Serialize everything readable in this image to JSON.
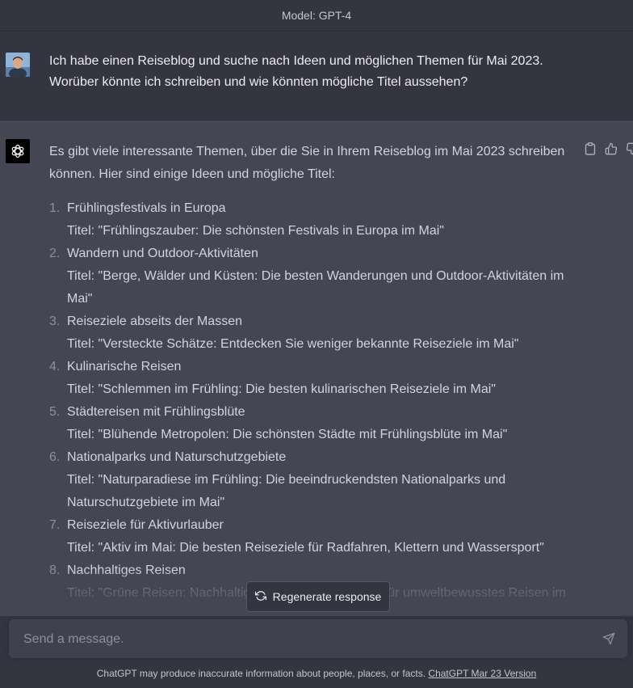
{
  "header": {
    "model_label": "Model: GPT-4"
  },
  "user_message": {
    "lines": [
      "Ich habe einen Reiseblog und suche nach Ideen und möglichen Themen für Mai 2023.",
      "Worüber könnte ich schreiben und wie könnten mögliche Titel aussehen?"
    ]
  },
  "assistant_message": {
    "intro": "Es gibt viele interessante Themen, über die Sie in Ihrem Reiseblog im Mai 2023 schreiben können. Hier sind einige Ideen und mögliche Titel:",
    "items": [
      {
        "num": "1.",
        "title": "Frühlingsfestivals in Europa",
        "subtitle": "Titel: \"Frühlingszauber: Die schönsten Festivals in Europa im Mai\""
      },
      {
        "num": "2.",
        "title": "Wandern und Outdoor-Aktivitäten",
        "subtitle": "Titel: \"Berge, Wälder und Küsten: Die besten Wanderungen und Outdoor-Aktivitäten im Mai\""
      },
      {
        "num": "3.",
        "title": "Reiseziele abseits der Massen",
        "subtitle": "Titel: \"Versteckte Schätze: Entdecken Sie weniger bekannte Reiseziele im Mai\""
      },
      {
        "num": "4.",
        "title": "Kulinarische Reisen",
        "subtitle": "Titel: \"Schlemmen im Frühling: Die besten kulinarischen Reiseziele im Mai\""
      },
      {
        "num": "5.",
        "title": "Städtereisen mit Frühlingsblüte",
        "subtitle": "Titel: \"Blühende Metropolen: Die schönsten Städte mit Frühlingsblüte im Mai\""
      },
      {
        "num": "6.",
        "title": "Nationalparks und Naturschutzgebiete",
        "subtitle": "Titel: \"Naturparadiese im Frühling: Die beeindruckendsten Nationalparks und Naturschutzgebiete im Mai\""
      },
      {
        "num": "7.",
        "title": "Reiseziele für Aktivurlauber",
        "subtitle": "Titel: \"Aktiv im Mai: Die besten Reiseziele für Radfahren, Klettern und Wassersport\""
      },
      {
        "num": "8.",
        "title": "Nachhaltiges Reisen",
        "subtitle": "Titel: \"Grüne Reisen: Nachhaltige Reiseziele und Tipps für umweltbewusstes Reisen im Mai\""
      }
    ]
  },
  "regenerate": {
    "label": "Regenerate response",
    "icon": "refresh-icon"
  },
  "composer": {
    "placeholder": "Send a message.",
    "value": "",
    "send_icon": "paper-plane-icon"
  },
  "footer": {
    "disclaimer": "ChatGPT may produce inaccurate information about people, places, or facts.",
    "version_link": "ChatGPT Mar 23 Version"
  },
  "icons": {
    "copy": "clipboard-icon",
    "thumbs_up": "thumbs-up-icon",
    "thumbs_down": "thumbs-down-icon",
    "gpt_logo": "openai-logo-icon",
    "user_avatar": "user-avatar"
  },
  "colors": {
    "user_bg": "#343541",
    "assistant_bg": "#444654",
    "gpt_avatar_bg": "#000000"
  }
}
